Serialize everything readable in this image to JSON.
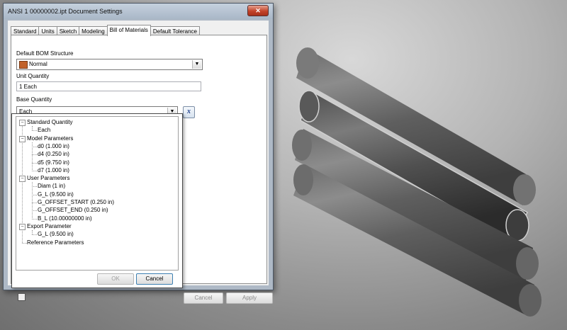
{
  "window": {
    "title": "ANSI 1 00000002.ipt Document Settings",
    "close_glyph": "✕"
  },
  "tabs": [
    {
      "label": "Standard",
      "active": false
    },
    {
      "label": "Units",
      "active": false
    },
    {
      "label": "Sketch",
      "active": false
    },
    {
      "label": "Modeling",
      "active": false
    },
    {
      "label": "Bill of Materials",
      "active": true
    },
    {
      "label": "Default Tolerance",
      "active": false
    }
  ],
  "bom": {
    "structure_label": "Default BOM Structure",
    "structure_value": "Normal",
    "unit_quantity_label": "Unit Quantity",
    "unit_quantity_value": "1 Each",
    "base_quantity_label": "Base Quantity",
    "base_quantity_value": "Each",
    "fx_glyph": "x"
  },
  "tree": {
    "groups": [
      {
        "name": "Standard Quantity",
        "items": [
          "Each"
        ]
      },
      {
        "name": "Model Parameters",
        "items": [
          "d0 (1.000 in)",
          "d4 (0.250 in)",
          "d5 (9.750 in)",
          "d7 (1.000 in)"
        ]
      },
      {
        "name": "User Parameters",
        "items": [
          "Diam (1 in)",
          "G_L (9.500 in)",
          "G_OFFSET_START (0.250 in)",
          "G_OFFSET_END (0.250 in)",
          "B_L (10.00000000 in)"
        ]
      },
      {
        "name": "Export Parameter",
        "items": [
          "G_L (9.500 in)"
        ]
      },
      {
        "name": "Reference Parameters",
        "items": []
      }
    ],
    "ok_label": "OK",
    "cancel_label": "Cancel"
  },
  "dialog_buttons": {
    "cancel_label": "Cancel",
    "apply_label": "Apply"
  },
  "colors": {
    "window_frame": "#aeb9c6",
    "close_button": "#c3432a",
    "bom_icon": "#c2622a"
  }
}
